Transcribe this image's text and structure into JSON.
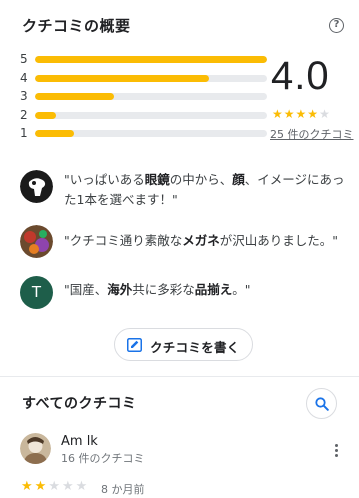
{
  "summary": {
    "title": "クチコミの概要",
    "help_icon": "help-circle-icon",
    "rating_bars": [
      {
        "stars": "5",
        "fraction": 1.0
      },
      {
        "stars": "4",
        "fraction": 0.75
      },
      {
        "stars": "3",
        "fraction": 0.34
      },
      {
        "stars": "2",
        "fraction": 0.09
      },
      {
        "stars": "1",
        "fraction": 0.17
      }
    ],
    "average": "4.0",
    "average_stars": 4,
    "review_count_link": "25 件のクチコミ",
    "colors": {
      "bar_fill": "#fbbc04",
      "bar_track": "#e8eaed"
    }
  },
  "snippets": [
    {
      "prefix": "\"いっぱいある",
      "bold1": "眼鏡",
      "mid1": "の中から、",
      "bold2": "顔",
      "suffix": "、イメージにあった1本を選べます！\""
    },
    {
      "prefix": "\"クチコミ通り素敵な",
      "bold1": "メガネ",
      "mid1": "が沢山ありました。\"",
      "bold2": "",
      "suffix": ""
    },
    {
      "prefix": "\"国産、",
      "bold1": "海外",
      "mid1": "共に多彩な",
      "bold2": "品揃え",
      "suffix": "。\""
    }
  ],
  "snippet_avatar_letter": "T",
  "write_review": {
    "label": "クチコミを書く",
    "icon": "edit-icon"
  },
  "all_reviews": {
    "title": "すべてのクチコミ",
    "search_icon": "search-icon"
  },
  "review": {
    "name": "Am lk",
    "count": "16 件のクチコミ",
    "stars": 2,
    "time": "8 か月前",
    "menu_icon": "more-vert-icon"
  }
}
